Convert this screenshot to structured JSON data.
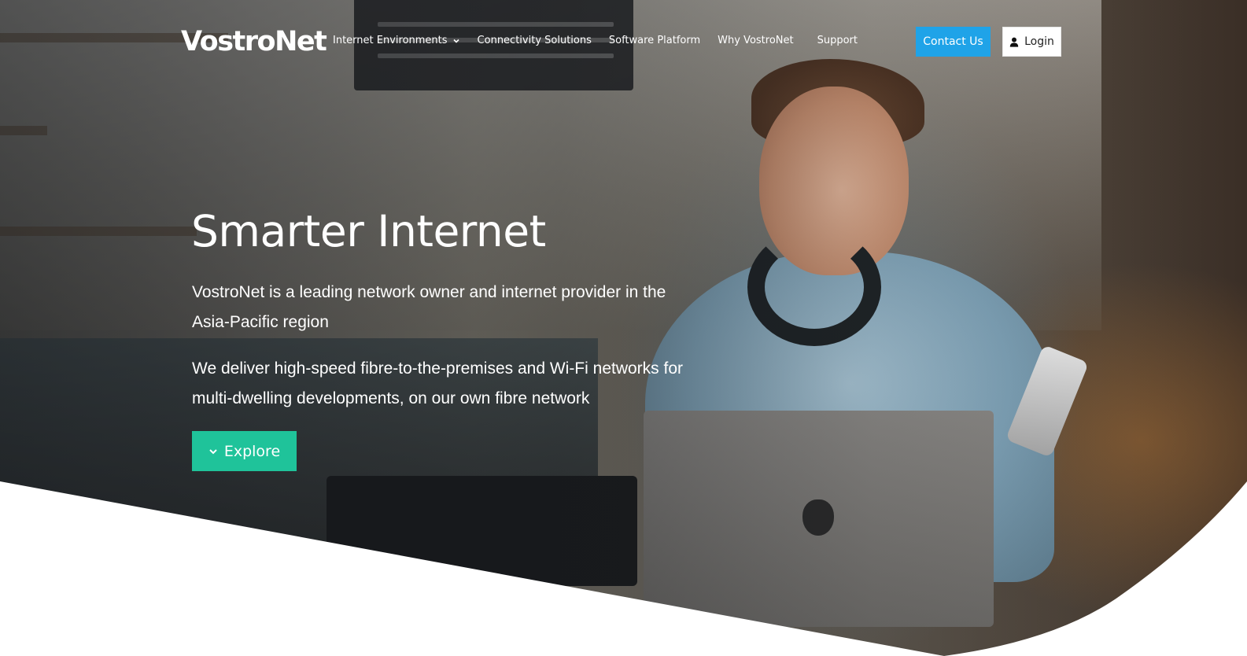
{
  "header": {
    "logo_text": "VostroNet",
    "nav": [
      {
        "label": "Internet Environments",
        "has_dropdown": true
      },
      {
        "label": "Connectivity Solutions",
        "has_dropdown": false
      },
      {
        "label": "Software Platform",
        "has_dropdown": false
      },
      {
        "label": "Why VostroNet",
        "has_dropdown": false
      },
      {
        "label": "Support",
        "has_dropdown": false
      }
    ],
    "contact_label": "Contact Us",
    "login_label": "Login"
  },
  "hero": {
    "title": "Smarter Internet",
    "paragraph_1": "VostroNet is a leading network owner and internet provider in the Asia-Pacific region",
    "paragraph_2": "We deliver high-speed fibre-to-the-premises and Wi-Fi networks for multi-dwelling developments, on our own fibre network",
    "explore_label": "Explore"
  },
  "colors": {
    "contact_button": "#1fa3e8",
    "explore_button": "#1fc39a",
    "text_on_hero": "#ffffff"
  },
  "icons": {
    "nav_dropdown": "chevron-down-icon",
    "login": "user-icon",
    "explore": "chevron-down-icon"
  }
}
